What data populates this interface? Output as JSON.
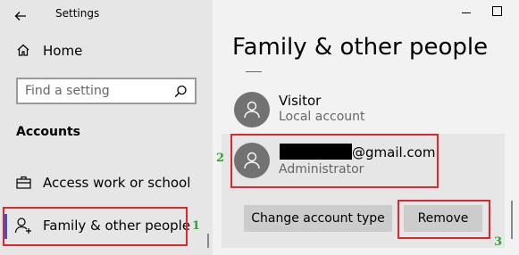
{
  "titlebar": {
    "app_title": "Settings"
  },
  "sidebar": {
    "home_label": "Home",
    "search_placeholder": "Find a setting",
    "section_title": "Accounts",
    "items": [
      {
        "label": "Access work or school",
        "icon": "briefcase-icon"
      },
      {
        "label": "Family & other people",
        "icon": "family-icon",
        "active": true
      }
    ]
  },
  "main": {
    "page_title": "Family & other people",
    "accounts": [
      {
        "name": "Visitor",
        "subtitle": "Local account"
      },
      {
        "name_suffix": "@gmail.com",
        "subtitle": "Administrator",
        "selected": true
      }
    ],
    "buttons": {
      "change_type": "Change account type",
      "remove": "Remove"
    }
  },
  "annotations": {
    "step1": "1",
    "step2": "2",
    "step3": "3",
    "highlight_color": "#e3262c",
    "number_color": "#2fa52f"
  }
}
